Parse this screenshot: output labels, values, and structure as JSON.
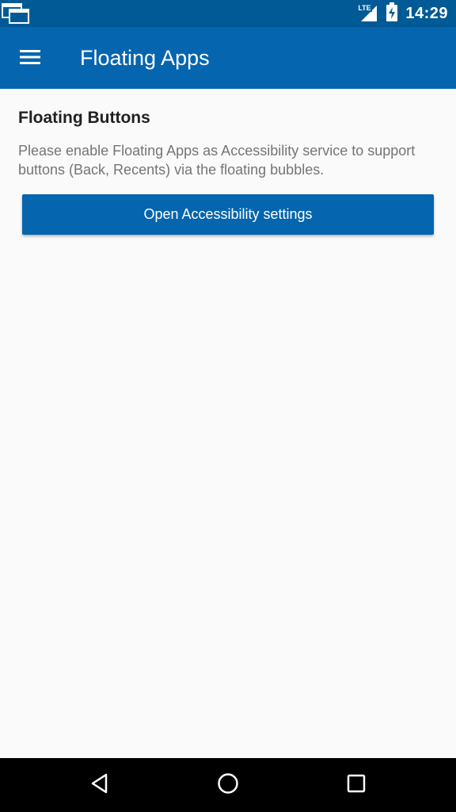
{
  "status_bar": {
    "time": "14:29",
    "network_label": "LTE",
    "icons": [
      "floating-apps-notification-icon",
      "signal-icon",
      "battery-charging-icon"
    ]
  },
  "app_bar": {
    "menu_icon": "hamburger-menu-icon",
    "title": "Floating Apps"
  },
  "content": {
    "section_title": "Floating Buttons",
    "description": "Please enable Floating Apps as Accessibility service to support buttons (Back, Recents) via the floating bubbles.",
    "button_label": "Open Accessibility settings"
  },
  "nav_bar": {
    "icons": [
      "back-icon",
      "home-icon",
      "recents-icon"
    ]
  },
  "colors": {
    "status_bar": "#005a96",
    "app_bar": "#0565ae",
    "button": "#0565ae",
    "background": "#fafafa",
    "title_text": "#212121",
    "desc_text": "#757575"
  }
}
